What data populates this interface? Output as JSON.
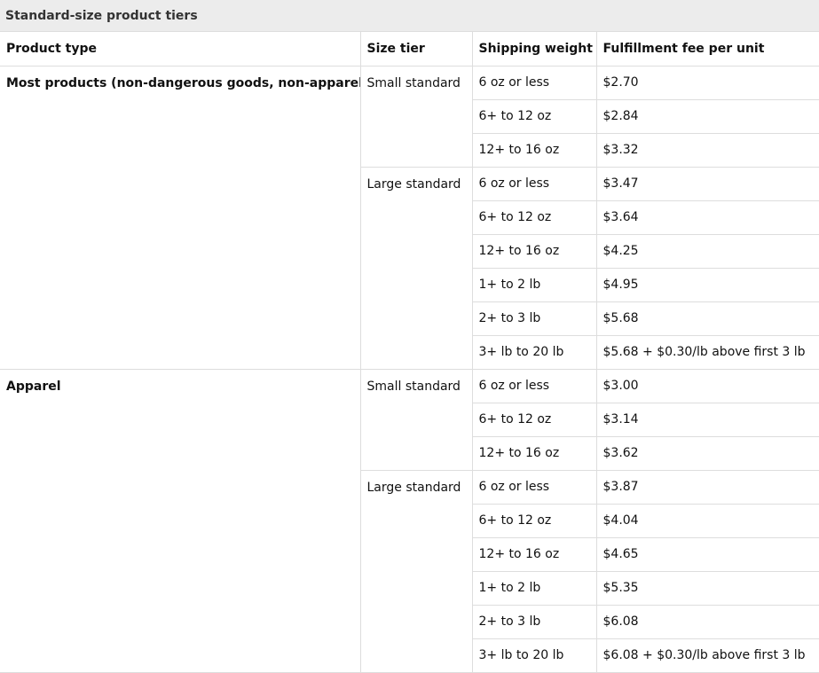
{
  "title": "Standard-size product tiers",
  "headers": {
    "product_type": "Product type",
    "size_tier": "Size tier",
    "shipping_weight": "Shipping weight",
    "fee": "Fulfillment fee per unit"
  },
  "groups": [
    {
      "product": "Most products (non-dangerous goods, non-apparel)",
      "tiers": [
        {
          "name": "Small standard",
          "rows": [
            {
              "weight": "6 oz or less",
              "fee": "$2.70"
            },
            {
              "weight": "6+ to 12 oz",
              "fee": "$2.84"
            },
            {
              "weight": "12+ to 16 oz",
              "fee": "$3.32"
            }
          ]
        },
        {
          "name": "Large standard",
          "rows": [
            {
              "weight": "6 oz or less",
              "fee": "$3.47"
            },
            {
              "weight": "6+ to 12 oz",
              "fee": "$3.64"
            },
            {
              "weight": "12+ to 16 oz",
              "fee": "$4.25"
            },
            {
              "weight": "1+ to 2 lb",
              "fee": "$4.95"
            },
            {
              "weight": "2+ to 3 lb",
              "fee": "$5.68"
            },
            {
              "weight": "3+ lb to 20 lb",
              "fee": "$5.68 + $0.30/lb above first 3 lb"
            }
          ]
        }
      ]
    },
    {
      "product": "Apparel",
      "tiers": [
        {
          "name": "Small standard",
          "rows": [
            {
              "weight": "6 oz or less",
              "fee": "$3.00"
            },
            {
              "weight": "6+ to 12 oz",
              "fee": "$3.14"
            },
            {
              "weight": "12+ to 16 oz",
              "fee": "$3.62"
            }
          ]
        },
        {
          "name": "Large standard",
          "rows": [
            {
              "weight": "6 oz or less",
              "fee": "$3.87"
            },
            {
              "weight": "6+ to 12 oz",
              "fee": "$4.04"
            },
            {
              "weight": "12+ to 16 oz",
              "fee": "$4.65"
            },
            {
              "weight": "1+ to 2 lb",
              "fee": "$5.35"
            },
            {
              "weight": "2+ to 3 lb",
              "fee": "$6.08"
            },
            {
              "weight": "3+ lb to 20 lb",
              "fee": "$6.08 + $0.30/lb above first 3 lb"
            }
          ]
        }
      ]
    }
  ]
}
